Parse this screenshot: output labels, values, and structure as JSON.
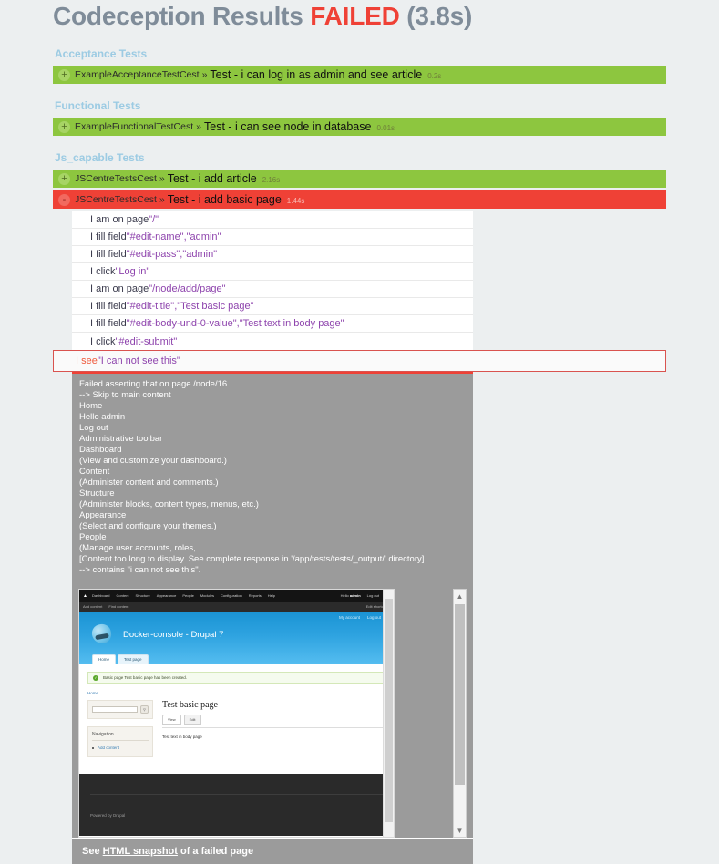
{
  "header": {
    "title": "Codeception Results",
    "status": "FAILED",
    "duration": "(3.8s)"
  },
  "suites": [
    {
      "name": "Acceptance Tests",
      "tests": [
        {
          "icon": "+",
          "class": "ExampleAcceptanceTestCest",
          "sep": "»",
          "name": "Test - i can log in as admin and see article",
          "time": "0.2s",
          "state": "ok"
        }
      ]
    },
    {
      "name": "Functional Tests",
      "tests": [
        {
          "icon": "+",
          "class": "ExampleFunctionalTestCest",
          "sep": "»",
          "name": "Test - i can see node in database",
          "time": "0.01s",
          "state": "ok"
        }
      ]
    },
    {
      "name": "Js_capable Tests",
      "tests": [
        {
          "icon": "+",
          "class": "JSCentreTestsCest",
          "sep": "»",
          "name": "Test - i add article",
          "time": "2.16s",
          "state": "ok"
        },
        {
          "icon": "-",
          "class": "JSCentreTestsCest",
          "sep": "»",
          "name": "Test - i add basic page",
          "time": "1.44s",
          "state": "err"
        }
      ]
    }
  ],
  "steps": [
    {
      "action": "I am on page ",
      "arg": "\"/\""
    },
    {
      "action": "I fill field ",
      "arg": "\"#edit-name\",\"admin\""
    },
    {
      "action": "I fill field ",
      "arg": "\"#edit-pass\",\"admin\""
    },
    {
      "action": "I click ",
      "arg": "\"Log in\""
    },
    {
      "action": "I am on page ",
      "arg": "\"/node/add/page\""
    },
    {
      "action": "I fill field ",
      "arg": "\"#edit-title\",\"Test basic page\""
    },
    {
      "action": "I fill field ",
      "arg": "\"#edit-body-und-0-value\",\"Test text in body page\""
    },
    {
      "action": "I click ",
      "arg": "\"#edit-submit\""
    }
  ],
  "failed_step": {
    "action": "I see ",
    "arg": "\"I can not see this\""
  },
  "failure_message": [
    "Failed asserting that on page /node/16",
    "--> Skip to main content",
    "Home",
    "Hello admin",
    "Log out",
    "Administrative toolbar",
    "Dashboard",
    "(View and customize your dashboard.)",
    "Content",
    "(Administer content and comments.)",
    "Structure",
    "(Administer blocks, content types, menus, etc.)",
    "Appearance",
    "(Select and configure your themes.)",
    "People",
    "(Manage user accounts, roles,",
    "[Content too long to display. See complete response in '/app/tests/tests/_output/' directory]",
    "--> contains \"i can not see this\"."
  ],
  "screenshot": {
    "toolbar_items": [
      "Dashboard",
      "Content",
      "Structure",
      "Appearance",
      "People",
      "Modules",
      "Configuration",
      "Reports",
      "Help"
    ],
    "toolbar_hello_prefix": "Hello",
    "toolbar_user": "admin",
    "toolbar_logout": "Log out",
    "shortcut_items": [
      "Add content",
      "Find content"
    ],
    "shortcut_edit": "Edit shortcuts",
    "user_links": [
      "My account",
      "Log out"
    ],
    "site_name": "Docker-console - Drupal 7",
    "tabs": [
      "Home",
      "Test page"
    ],
    "status_message": "Basic page Test basic page has been created.",
    "breadcrumb": "Home",
    "nav_title": "Navigation",
    "nav_items": [
      "Add content"
    ],
    "node_title": "Test basic page",
    "node_tabs": [
      "View",
      "Edit"
    ],
    "node_body": "Test text in body page",
    "footer": "Powered by Drupal"
  },
  "snapshot_bar": {
    "prefix": "See ",
    "link": "HTML snapshot",
    "suffix": " of a failed page"
  },
  "colors": {
    "pass": "#8dc63f",
    "fail": "#ef4136",
    "suite_header": "#9ccbe3",
    "title": "#7f8c99",
    "background": "#eceff0",
    "fail_panel": "#9b9b9b"
  }
}
